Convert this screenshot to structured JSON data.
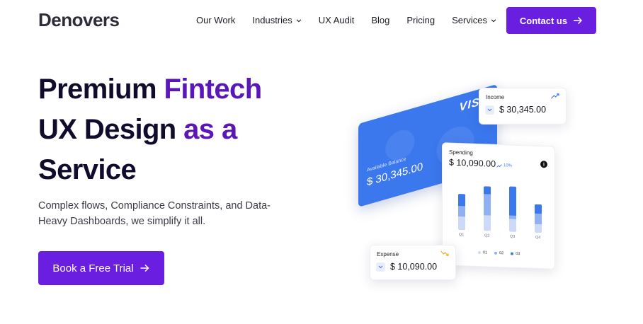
{
  "brand": {
    "logo": "Denovers",
    "accent": "#6a1fe0",
    "title_purple": "#5b16b8"
  },
  "nav": {
    "items": [
      {
        "label": "Our Work",
        "dropdown": false
      },
      {
        "label": "Industries",
        "dropdown": true
      },
      {
        "label": "UX Audit",
        "dropdown": false
      },
      {
        "label": "Blog",
        "dropdown": false
      },
      {
        "label": "Pricing",
        "dropdown": false
      },
      {
        "label": "Services",
        "dropdown": true
      }
    ],
    "contact_label": "Contact us"
  },
  "hero": {
    "title_line1_dark": "Premium ",
    "title_line1_purple": "Fintech",
    "title_line2_dark": "UX Design ",
    "title_line2_purple": "as a",
    "title_line3_dark": "Service",
    "subtitle": "Complex flows, Compliance Constraints, and Data-Heavy Dashboards, we simplify it all.",
    "cta_label": "Book a Free Trial"
  },
  "illustration": {
    "card": {
      "brand": "VISA",
      "balance_label": "Available Balance",
      "balance_value": "$ 30,345.00"
    },
    "income": {
      "label": "Income",
      "value": "$ 30,345.00"
    },
    "expense": {
      "label": "Expense",
      "value": "$ 10,090.00"
    },
    "spending": {
      "label": "Spending",
      "value": "$ 10,090.00",
      "change": "10%",
      "quarters": [
        {
          "label": "Q1",
          "total": 0.55,
          "mid": 0.35,
          "top": 0.18
        },
        {
          "label": "Q2",
          "total": 0.68,
          "mid": 0.45,
          "top": 0.12
        },
        {
          "label": "Q3",
          "total": 0.7,
          "mid": 0.5,
          "top": 0.45
        },
        {
          "label": "Q4",
          "total": 0.44,
          "mid": 0.3,
          "top": 0.14
        }
      ],
      "legend": [
        "01",
        "02",
        "03"
      ],
      "legend_colors": [
        "#ccdaf8",
        "#8fb0f2",
        "#3b78ee"
      ]
    }
  }
}
